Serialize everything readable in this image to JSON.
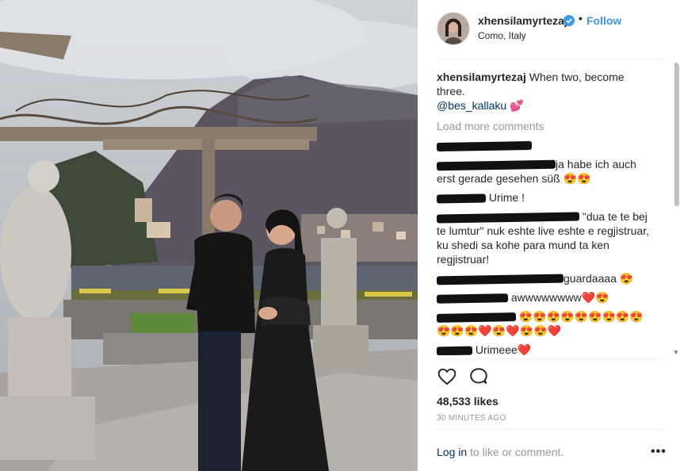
{
  "post": {
    "username": "xhensilamyrtezaj",
    "follow_label": "Follow",
    "dot": "•",
    "location": "Como, Italy",
    "caption_user": "xhensilamyrtezaj",
    "caption_text": " When two, become three.",
    "caption_mention": "@bes_kallaku",
    "caption_emoji": " 💕",
    "load_more": "Load more comments",
    "likes": "48,533 likes",
    "time": "30 MINUTES AGO",
    "login_link": "Log in",
    "login_text": " to like or comment.",
    "more_options": "•••"
  },
  "comments": [
    {
      "text": ""
    },
    {
      "text": "ja habe ich auch erst gerade gesehen süß 😍😍"
    },
    {
      "text": "Urime !"
    },
    {
      "text": "\"dua te te bej te lumtur\" nuk eshte live eshte e regjistruar, ku shedi sa kohe para mund ta ken regjistruar!"
    },
    {
      "text": "guardaaaa 😍"
    },
    {
      "text": "awwwwwwww❤️😍"
    },
    {
      "text": "😍😍😍😍😍😍😍😍😍😍😍😍❤️😍❤️😍😍❤️"
    },
    {
      "text": "Urimeee❤️"
    },
    {
      "text": "❤️❤️❤️"
    }
  ],
  "icons": {
    "verified": "verified-badge-icon",
    "heart": "heart-icon",
    "comment": "comment-icon",
    "more": "more-options-icon"
  },
  "colors": {
    "link": "#3897f0",
    "mention": "#003569",
    "muted": "#999999"
  }
}
